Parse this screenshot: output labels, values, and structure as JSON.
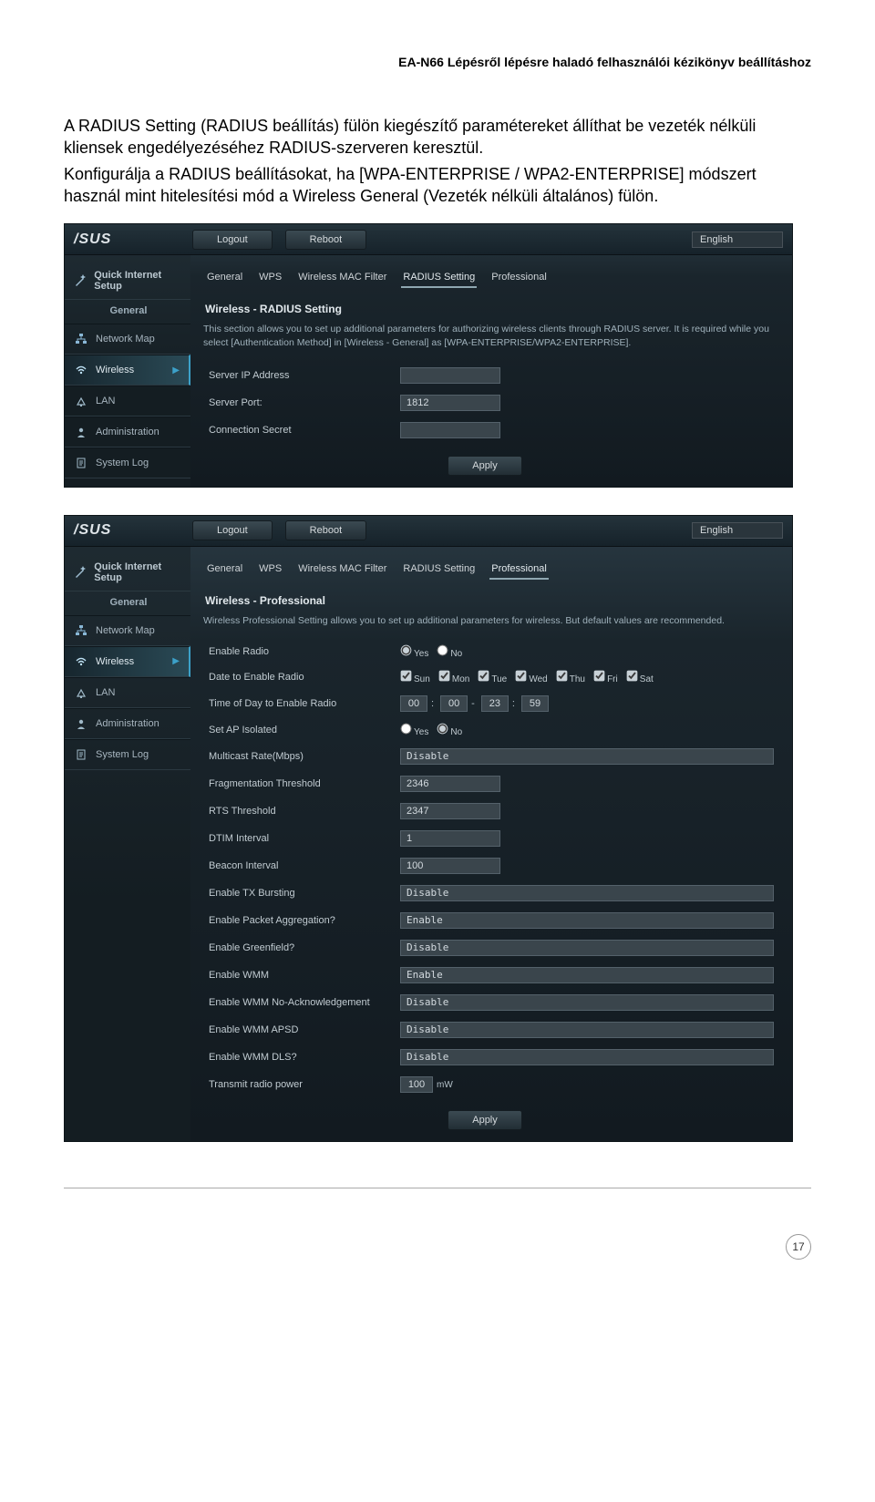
{
  "doc": {
    "header": "EA-N66 Lépésről lépésre haladó felhasználói kézikönyv beállításhoz",
    "para1": "A RADIUS Setting (RADIUS beállítás) fülön kiegészítő paramétereket állíthat be vezeték nélküli kliensek engedélyezéséhez RADIUS-szerveren keresztül.",
    "para2": "Konfigurálja a RADIUS beállításokat, ha [WPA-ENTERPRISE / WPA2-ENTERPRISE] módszert használ mint hitelesítési mód a Wireless General (Vezeték nélküli általános) fülön.",
    "pageNumber": "17"
  },
  "common": {
    "brand": "/SUS",
    "logout": "Logout",
    "reboot": "Reboot",
    "language": "English",
    "apply": "Apply",
    "qis": "Quick Internet Setup",
    "group_general": "General",
    "sidebar": {
      "network_map": "Network Map",
      "wireless": "Wireless",
      "lan": "LAN",
      "administration": "Administration",
      "system_log": "System Log"
    },
    "tabs": {
      "general": "General",
      "wps": "WPS",
      "macfilter": "Wireless MAC Filter",
      "radius": "RADIUS Setting",
      "professional": "Professional"
    }
  },
  "radius": {
    "title": "Wireless - RADIUS Setting",
    "desc": "This section allows you to set up additional parameters for authorizing wireless clients through RADIUS server. It is required while you select [Authentication Method] in [Wireless - General] as [WPA-ENTERPRISE/WPA2-ENTERPRISE].",
    "rows": {
      "server_ip": "Server IP Address",
      "server_port": "Server Port:",
      "secret": "Connection Secret"
    },
    "values": {
      "port": "1812"
    }
  },
  "pro": {
    "title": "Wireless - Professional",
    "desc": "Wireless Professional Setting allows you to set up additional parameters for wireless. But default values are recommended.",
    "rows": {
      "enable_radio": "Enable Radio",
      "date_enable": "Date to Enable Radio",
      "time_enable": "Time of Day to Enable Radio",
      "ap_isolated": "Set AP Isolated",
      "multicast": "Multicast Rate(Mbps)",
      "frag": "Fragmentation Threshold",
      "rts": "RTS Threshold",
      "dtim": "DTIM Interval",
      "beacon": "Beacon Interval",
      "tx_burst": "Enable TX Bursting",
      "packet_agg": "Enable Packet Aggregation?",
      "greenfield": "Enable Greenfield?",
      "wmm": "Enable WMM",
      "wmm_noack": "Enable WMM No-Acknowledgement",
      "wmm_apsd": "Enable WMM APSD",
      "wmm_dls": "Enable WMM DLS?",
      "tx_power": "Transmit radio power"
    },
    "vals": {
      "yes": "Yes",
      "no": "No",
      "sun": "Sun",
      "mon": "Mon",
      "tue": "Tue",
      "wed": "Wed",
      "thu": "Thu",
      "fri": "Fri",
      "sat": "Sat",
      "t1": "00",
      "t2": "00",
      "t3": "23",
      "t4": "59",
      "multicast": "Disable",
      "frag": "2346",
      "rts": "2347",
      "dtim": "1",
      "beacon": "100",
      "tx_burst": "Disable",
      "packet_agg": "Enable",
      "greenfield": "Disable",
      "wmm": "Enable",
      "wmm_noack": "Disable",
      "wmm_apsd": "Disable",
      "wmm_dls": "Disable",
      "tx_power": "100",
      "tx_power_unit": "mW"
    }
  }
}
